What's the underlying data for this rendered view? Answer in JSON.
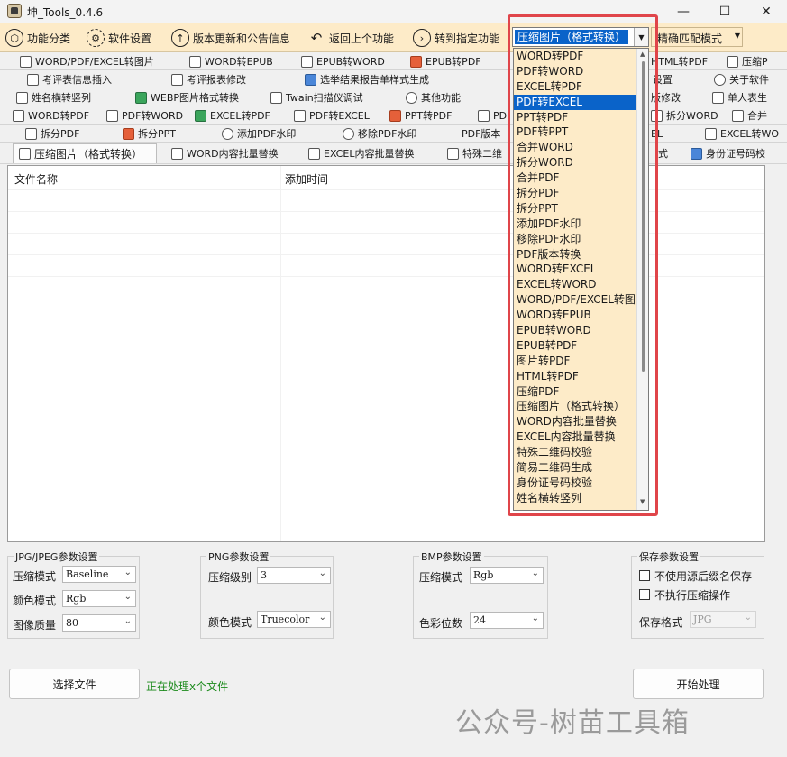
{
  "window": {
    "title": "坤_Tools_0.4.6"
  },
  "toolbar": {
    "feature_category": "功能分类",
    "software_settings": "软件设置",
    "update_notice": "版本更新和公告信息",
    "back": "返回上个功能",
    "goto_feature": "转到指定功能",
    "goto_value": "压缩图片（格式转换）",
    "match_mode": "精确匹配模式"
  },
  "tabs": {
    "row1": [
      "WORD/PDF/EXCEL转图片",
      "WORD转EPUB",
      "EPUB转WORD",
      "EPUB转PDF",
      "HTML转PDF",
      "压缩P"
    ],
    "row2": [
      "考评表信息插入",
      "考评报表修改",
      "选举结果报告单样式生成",
      "设置",
      "关于软件"
    ],
    "row3": [
      "姓名横转竖列",
      "WEBP图片格式转换",
      "Twain扫描仪调试",
      "其他功能",
      "版修改",
      "单人表生"
    ],
    "row4": [
      "WORD转PDF",
      "PDF转WORD",
      "EXCEL转PDF",
      "PDF转EXCEL",
      "PPT转PDF",
      "PD",
      "拆分WORD",
      "合并"
    ],
    "row5": [
      "拆分PDF",
      "拆分PPT",
      "添加PDF水印",
      "移除PDF水印",
      "PDF版本",
      "EL",
      "EXCEL转WO"
    ],
    "row6": [
      "压缩图片（格式转换）",
      "WORD内容批量替换",
      "EXCEL内容批量替换",
      "特殊二维",
      "式",
      "身份证号码校"
    ]
  },
  "filelist": {
    "col_name": "文件名称",
    "col_time": "添加时间"
  },
  "jpg": {
    "title": "JPG/JPEG参数设置",
    "mode_label": "压缩模式",
    "mode_value": "Baseline",
    "color_label": "颜色模式",
    "color_value": "Rgb",
    "quality_label": "图像质量",
    "quality_value": "80"
  },
  "png": {
    "title": "PNG参数设置",
    "level_label": "压缩级别",
    "level_value": "3",
    "color_label": "颜色模式",
    "color_value": "Truecolor"
  },
  "bmp": {
    "title": "BMP参数设置",
    "mode_label": "压缩模式",
    "mode_value": "Rgb",
    "depth_label": "色彩位数",
    "depth_value": "24"
  },
  "save": {
    "title": "保存参数设置",
    "opt1": "不使用源后缀名保存",
    "opt2": "不执行压缩操作",
    "format_label": "保存格式",
    "format_value": "JPG"
  },
  "bottom": {
    "select_file": "选择文件",
    "status": "正在处理x个文件",
    "start": "开始处理"
  },
  "watermark": "公众号-树苗工具箱",
  "dropdown": {
    "selected_index": 3,
    "items": [
      "WORD转PDF",
      "PDF转WORD",
      "EXCEL转PDF",
      "PDF转EXCEL",
      "PPT转PDF",
      "PDF转PPT",
      "合并WORD",
      "拆分WORD",
      "合并PDF",
      "拆分PDF",
      "拆分PPT",
      "添加PDF水印",
      "移除PDF水印",
      "PDF版本转换",
      "WORD转EXCEL",
      "EXCEL转WORD",
      "WORD/PDF/EXCEL转图",
      "WORD转EPUB",
      "EPUB转WORD",
      "EPUB转PDF",
      "图片转PDF",
      "HTML转PDF",
      "压缩PDF",
      "压缩图片（格式转换）",
      "WORD内容批量替换",
      "EXCEL内容批量替换",
      "特殊二维码校验",
      "简易二维码生成",
      "身份证号码校验",
      "姓名横转竖列"
    ]
  },
  "colors": {
    "accent": "#0a63c9",
    "toolbar_bg": "#fdebc8",
    "highlight": "#e0454a",
    "status": "#1b8a1b"
  }
}
